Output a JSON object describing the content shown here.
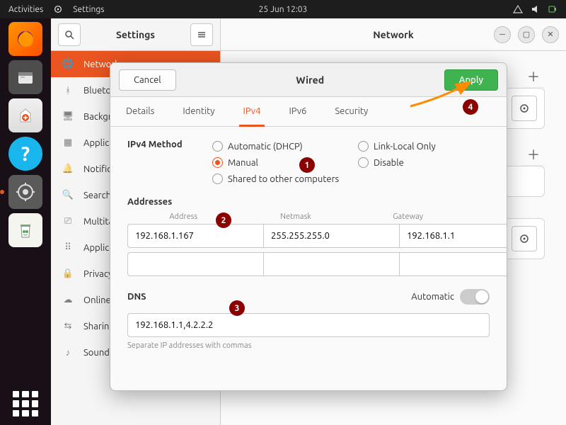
{
  "topbar": {
    "activities": "Activities",
    "app": "Settings",
    "datetime": "25 Jun  12:03"
  },
  "sidebar": {
    "title": "Settings",
    "items": [
      {
        "icon": "globe",
        "label": "Network"
      },
      {
        "icon": "bluetooth",
        "label": "Bluetooth"
      },
      {
        "icon": "display",
        "label": "Background"
      },
      {
        "icon": "grid",
        "label": "Applications"
      },
      {
        "icon": "bell",
        "label": "Notifications"
      },
      {
        "icon": "search",
        "label": "Search"
      },
      {
        "icon": "device",
        "label": "Multitasking"
      },
      {
        "icon": "apps",
        "label": "Applications"
      },
      {
        "icon": "lock",
        "label": "Privacy"
      },
      {
        "icon": "cloud",
        "label": "Online Accounts"
      },
      {
        "icon": "share",
        "label": "Sharing"
      },
      {
        "icon": "sound",
        "label": "Sound"
      }
    ]
  },
  "content": {
    "title": "Network"
  },
  "dialog": {
    "cancel": "Cancel",
    "apply": "Apply",
    "title": "Wired",
    "tabs": [
      "Details",
      "Identity",
      "IPv4",
      "IPv6",
      "Security"
    ],
    "active_tab": "IPv4",
    "method_label": "IPv4 Method",
    "methods": {
      "auto": "Automatic (DHCP)",
      "manual": "Manual",
      "shared": "Shared to other computers",
      "linklocal": "Link-Local Only",
      "disable": "Disable"
    },
    "selected_method": "manual",
    "addresses": {
      "title": "Addresses",
      "headers": {
        "address": "Address",
        "netmask": "Netmask",
        "gateway": "Gateway"
      },
      "rows": [
        {
          "address": "192.168.1.167",
          "netmask": "255.255.255.0",
          "gateway": "192.168.1.1"
        },
        {
          "address": "",
          "netmask": "",
          "gateway": ""
        }
      ]
    },
    "dns": {
      "title": "DNS",
      "automatic_label": "Automatic",
      "automatic": false,
      "value": "192.168.1.1,4.2.2.2",
      "hint": "Separate IP addresses with commas"
    }
  },
  "callouts": {
    "c1": "1",
    "c2": "2",
    "c3": "3",
    "c4": "4"
  },
  "colors": {
    "accent": "#e95420",
    "apply": "#3eb34f",
    "callout": "#8b0000"
  }
}
